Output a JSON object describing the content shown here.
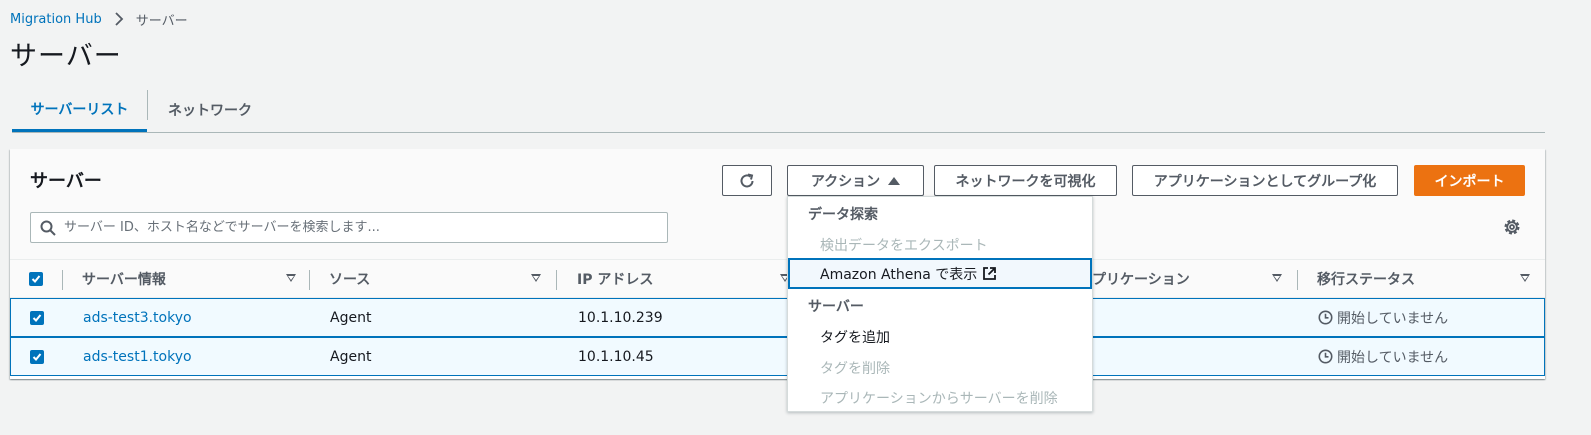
{
  "breadcrumb": {
    "root": "Migration Hub",
    "current": "サーバー"
  },
  "page": {
    "title": "サーバー"
  },
  "tabs": [
    {
      "label": "サーバーリスト",
      "active": true
    },
    {
      "label": "ネットワーク",
      "active": false
    }
  ],
  "panel": {
    "title": "サーバー",
    "buttons": {
      "actions": "アクション",
      "visualize_network": "ネットワークを可視化",
      "group_as_application": "アプリケーションとしてグループ化",
      "import": "インポート"
    },
    "search": {
      "placeholder": "サーバー ID、ホスト名などでサーバーを検索します..."
    }
  },
  "table": {
    "columns": [
      "サーバー情報",
      "ソース",
      "IP アドレス",
      "アプリケーション",
      "移行ステータス"
    ],
    "rows": [
      {
        "server": "ads-test3.tokyo",
        "source": "Agent",
        "ip": "10.1.10.239",
        "status": "開始していません",
        "selected": true
      },
      {
        "server": "ads-test1.tokyo",
        "source": "Agent",
        "ip": "10.1.10.45",
        "status": "開始していません",
        "selected": true
      }
    ]
  },
  "dropdown": {
    "group1": "データ探索",
    "item_export": "検出データをエクスポート",
    "item_athena": "Amazon Athena で表示",
    "group2": "サーバー",
    "item_add_tag": "タグを追加",
    "item_remove_tag": "タグを削除",
    "item_remove_from_app": "アプリケーションからサーバーを削除"
  },
  "colors": {
    "accent": "#0073bb",
    "import_button": "#ec7211",
    "selected_row_bg": "#f1faff"
  }
}
